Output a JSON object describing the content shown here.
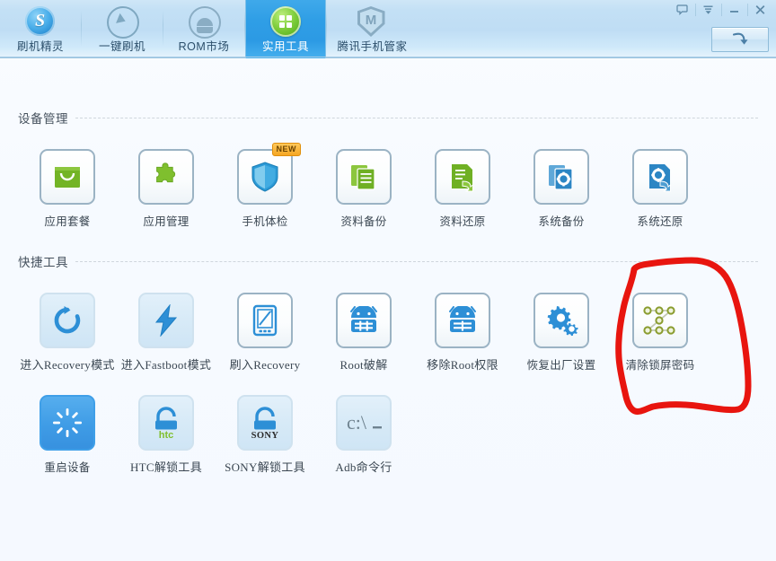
{
  "window": {
    "controls": [
      {
        "name": "feedback-icon",
        "title": "反馈"
      },
      {
        "name": "menu-icon",
        "title": "菜单"
      },
      {
        "name": "minimize-icon",
        "title": "最小化"
      },
      {
        "name": "close-icon",
        "title": "关闭"
      }
    ],
    "download_button_label": ""
  },
  "nav": {
    "tabs": [
      {
        "label": "刷机精灵",
        "icon": "logo-icon",
        "active": false
      },
      {
        "label": "一键刷机",
        "icon": "cursor-icon",
        "active": false
      },
      {
        "label": "ROM市场",
        "icon": "android-icon",
        "active": false
      },
      {
        "label": "实用工具",
        "icon": "grid-icon",
        "active": true
      },
      {
        "label": "腾讯手机管家",
        "icon": "shield-m-icon",
        "active": false
      }
    ]
  },
  "sections": [
    {
      "title": "设备管理",
      "rows": [
        [
          {
            "label": "应用套餐",
            "icon": "app-package-icon",
            "tile": "plain",
            "badge": null
          },
          {
            "label": "应用管理",
            "icon": "puzzle-icon",
            "tile": "plain",
            "badge": null
          },
          {
            "label": "手机体检",
            "icon": "shield-check-icon",
            "tile": "plain",
            "badge": "NEW"
          },
          {
            "label": "资料备份",
            "icon": "docs-green-icon",
            "tile": "plain",
            "badge": null
          },
          {
            "label": "资料还原",
            "icon": "doc-restore-icon",
            "tile": "plain",
            "badge": null
          },
          {
            "label": "系统备份",
            "icon": "system-backup-icon",
            "tile": "plain",
            "badge": null
          },
          {
            "label": "系统还原",
            "icon": "system-restore-icon",
            "tile": "plain",
            "badge": null
          }
        ]
      ]
    },
    {
      "title": "快捷工具",
      "rows": [
        [
          {
            "label": "进入Recovery模式",
            "icon": "refresh-icon",
            "tile": "soft",
            "badge": null,
            "serif": true
          },
          {
            "label": "进入Fastboot模式",
            "icon": "bolt-icon",
            "tile": "soft",
            "badge": null,
            "serif": true
          },
          {
            "label": "刷入Recovery",
            "icon": "phone-edit-icon",
            "tile": "plain",
            "badge": null,
            "serif": true
          },
          {
            "label": "Root破解",
            "icon": "android-root-icon",
            "tile": "plain",
            "badge": null,
            "serif": true
          },
          {
            "label": "移除Root权限",
            "icon": "android-unroot-icon",
            "tile": "plain",
            "badge": null,
            "serif": true
          },
          {
            "label": "恢复出厂设置",
            "icon": "gears-icon",
            "tile": "plain",
            "badge": null,
            "serif": false
          },
          {
            "label": "清除锁屏密码",
            "icon": "pattern-lock-icon",
            "tile": "plain",
            "badge": null,
            "serif": false,
            "annotated": true
          }
        ],
        [
          {
            "label": "重启设备",
            "icon": "reboot-spinner-icon",
            "tile": "solid",
            "badge": null,
            "serif": false
          },
          {
            "label": "HTC解锁工具",
            "icon": "htc-unlock-icon",
            "tile": "soft",
            "badge": null,
            "serif": true
          },
          {
            "label": "SONY解锁工具",
            "icon": "sony-unlock-icon",
            "tile": "soft",
            "badge": null,
            "serif": true
          },
          {
            "label": "Adb命令行",
            "icon": "cmd-prompt-icon",
            "tile": "soft",
            "badge": null,
            "serif": true
          }
        ]
      ]
    }
  ],
  "annotation": {
    "shape": "hand-drawn-circle",
    "color": "#e8150f",
    "targets": "清除锁屏密码"
  }
}
